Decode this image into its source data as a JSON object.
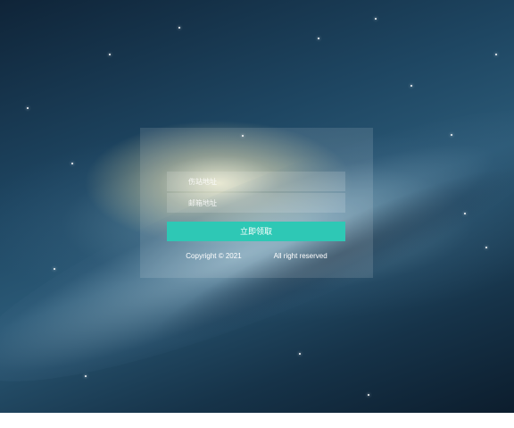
{
  "form": {
    "field1_placeholder": "伤站地址",
    "field2_placeholder": "邮箱地址",
    "submit_label": "立即领取"
  },
  "footer": {
    "prefix": "Copyright © 2021 ",
    "link_text": "　　　　",
    "suffix": " All right reserved"
  },
  "colors": {
    "accent": "#2ec8b5"
  }
}
